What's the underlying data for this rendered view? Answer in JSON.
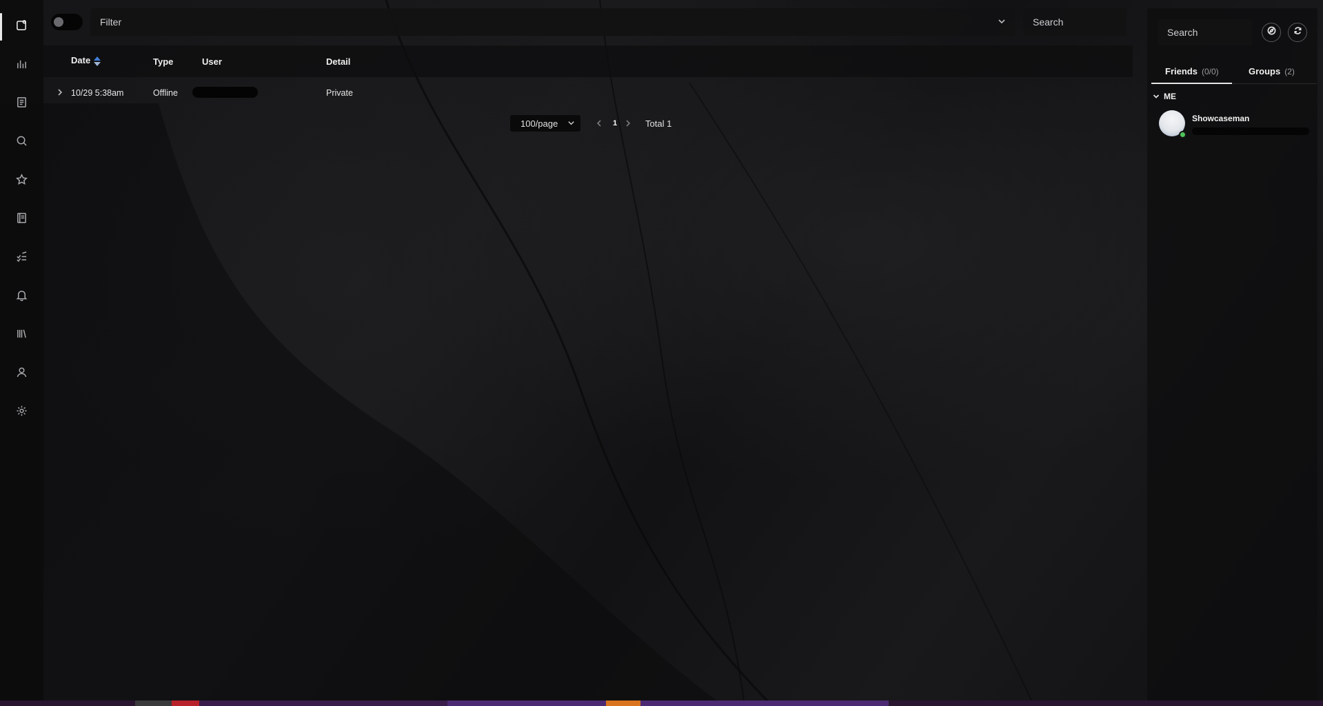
{
  "filter": {
    "placeholder": "Filter"
  },
  "top_search": {
    "placeholder": "Search"
  },
  "nav": {
    "items": [
      {
        "icon": "feed-icon"
      },
      {
        "icon": "chart-icon"
      },
      {
        "icon": "document-icon"
      },
      {
        "icon": "search-icon"
      },
      {
        "icon": "star-icon"
      },
      {
        "icon": "book-icon"
      },
      {
        "icon": "checklist-icon"
      },
      {
        "icon": "bell-icon"
      },
      {
        "icon": "library-icon"
      },
      {
        "icon": "user-icon"
      },
      {
        "icon": "gear-icon"
      }
    ]
  },
  "table": {
    "headers": {
      "date": "Date",
      "type": "Type",
      "user": "User",
      "detail": "Detail"
    },
    "rows": [
      {
        "date": "10/29 5:38am",
        "type": "Offline",
        "user": "",
        "detail": "Private"
      }
    ]
  },
  "pagination": {
    "page_size": "100/page",
    "current_page": "1",
    "total": "Total 1"
  },
  "right_panel": {
    "search_placeholder": "Search",
    "tabs": [
      {
        "label": "Friends",
        "count": "(0/0)"
      },
      {
        "label": "Groups",
        "count": "(2)"
      }
    ],
    "group_label": "ME",
    "friend": {
      "name": "Showcaseman",
      "status": "online"
    }
  },
  "colors": {
    "accent_sort": "#3f7fd9",
    "online": "#4fc35a",
    "background": "#151517"
  }
}
